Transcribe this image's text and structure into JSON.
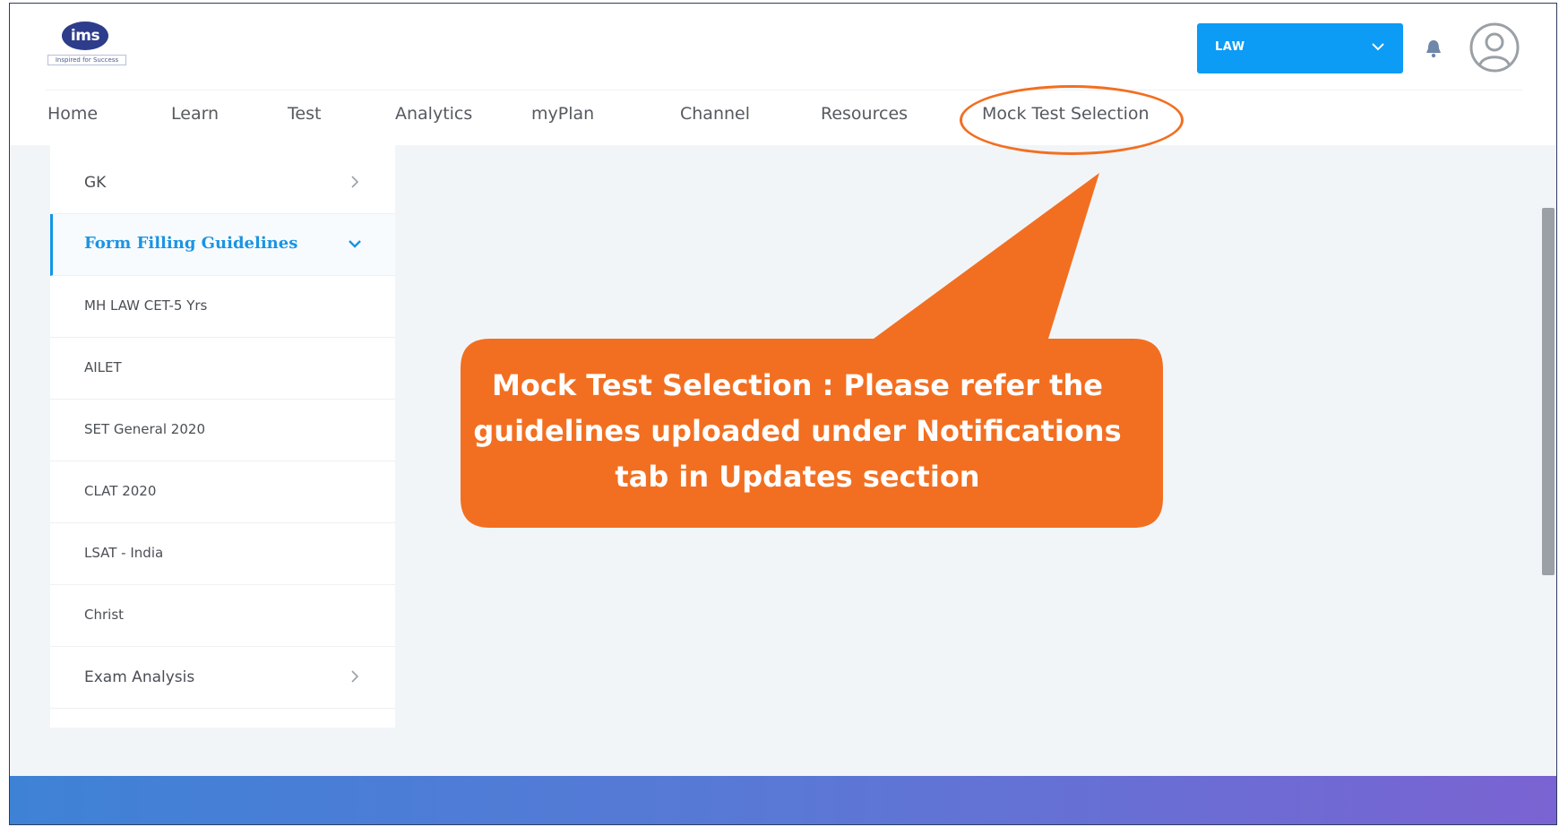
{
  "header": {
    "logo_text": "ims",
    "logo_tagline": "Inspired for Success",
    "course_select": "LAW"
  },
  "nav": {
    "items": [
      {
        "label": "Home"
      },
      {
        "label": "Learn"
      },
      {
        "label": "Test"
      },
      {
        "label": "Analytics"
      },
      {
        "label": "myPlan"
      },
      {
        "label": "Channel"
      },
      {
        "label": "Resources"
      },
      {
        "label": "Mock Test Selection"
      }
    ]
  },
  "sidebar": {
    "items": [
      {
        "label": "GK",
        "has_chevron": true,
        "chevron": "chevron-right-icon"
      },
      {
        "label": "Form Filling Guidelines",
        "active": true,
        "chevron": "chevron-down-icon"
      },
      {
        "label": "MH LAW CET-5 Yrs"
      },
      {
        "label": "AILET"
      },
      {
        "label": "SET General 2020"
      },
      {
        "label": "CLAT 2020"
      },
      {
        "label": "LSAT - India"
      },
      {
        "label": "Christ"
      },
      {
        "label": "Exam Analysis",
        "has_chevron": true,
        "chevron": "chevron-right-icon"
      }
    ]
  },
  "callout": {
    "text_line1": "Mock Test Selection : Please refer the",
    "text_line2": "guidelines uploaded under Notifications",
    "text_line3": "tab in Updates section",
    "color": "#f26f21"
  },
  "colors": {
    "accent": "#0c9bf5",
    "active_link": "#1b94e3",
    "callout": "#f26f21",
    "footer_start": "#3e82d6",
    "footer_end": "#7a63d2"
  }
}
